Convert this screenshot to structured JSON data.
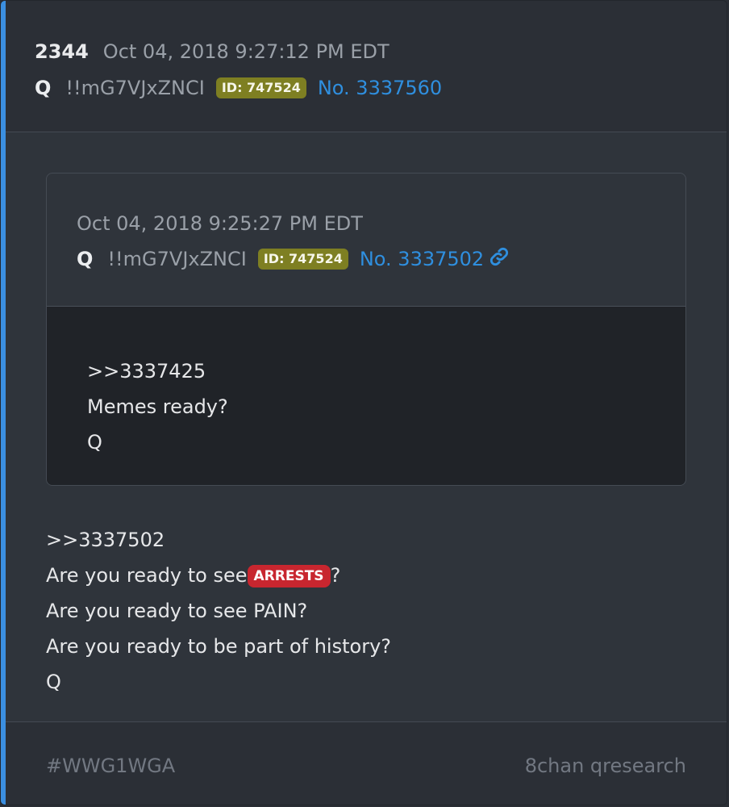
{
  "post": {
    "number": "2344",
    "date": "Oct 04, 2018 9:27:12 PM EDT",
    "name": "Q",
    "tripcode": "!!mG7VJxZNCI",
    "id_badge": "ID: 747524",
    "post_no": "No. 3337560"
  },
  "quoted": {
    "date": "Oct 04, 2018 9:25:27 PM EDT",
    "name": "Q",
    "tripcode": "!!mG7VJxZNCI",
    "id_badge": "ID: 747524",
    "post_no": "No. 3337502",
    "lines": [
      ">>3337425",
      "Memes ready?",
      "Q"
    ]
  },
  "body": {
    "line1": ">>3337502",
    "line2_prefix": "Are you ready to see",
    "line2_badge": "ARRESTS",
    "line2_suffix": "?",
    "line3": "Are you ready to see PAIN?",
    "line4": "Are you ready to be part of history?",
    "line5": "Q"
  },
  "footer": {
    "tag": "#WWG1WGA",
    "source": "8chan qresearch"
  },
  "colors": {
    "accent_bar": "#3b8fe0",
    "id_badge": "#7e7f22",
    "link": "#2f8fdf",
    "arrests_badge": "#c8262f"
  },
  "icons": {
    "link": "link-icon"
  }
}
